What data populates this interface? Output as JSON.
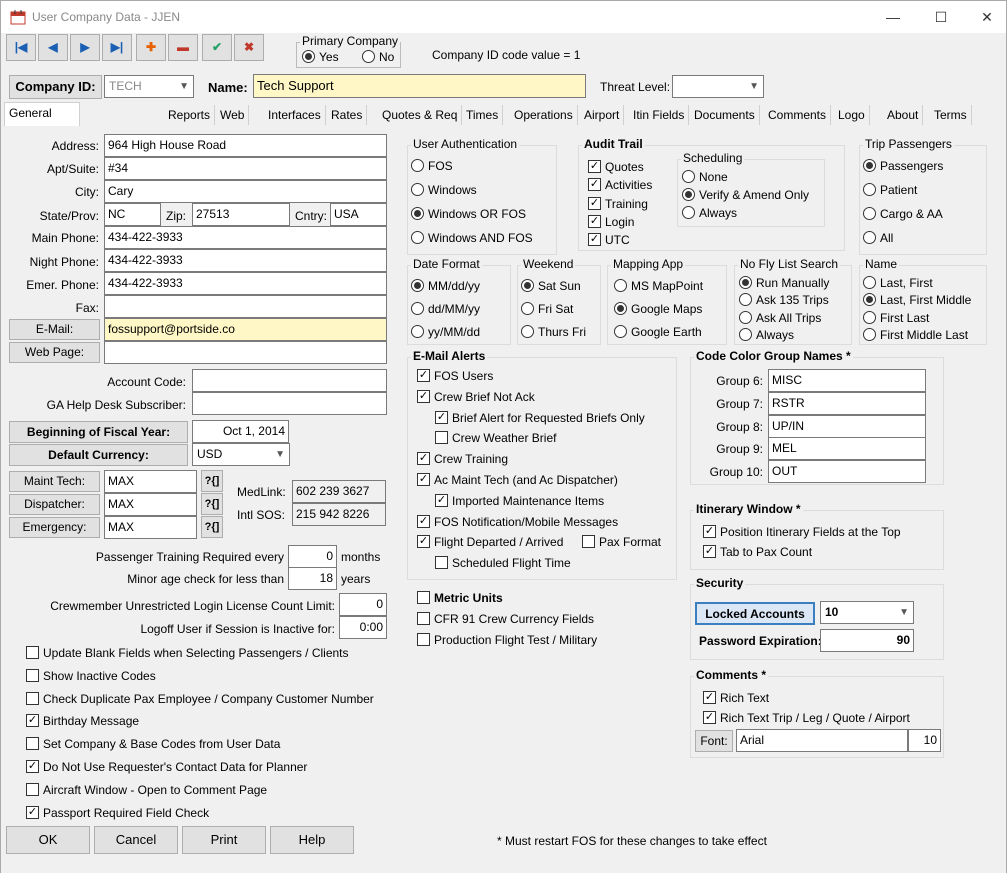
{
  "window": {
    "title": "User Company Data - JJEN",
    "min": "—",
    "max": "☐",
    "close": "✕"
  },
  "toolbar": [
    "|◀",
    "◀",
    "▶",
    "▶|",
    "✚",
    "▬",
    "✔",
    "✖"
  ],
  "primary_company": {
    "label": "Primary Company",
    "yes": "Yes",
    "no": "No",
    "code_value": "Company ID code value = 1"
  },
  "header": {
    "company_id_label": "Company ID:",
    "company_id_value": "TECH",
    "name_label": "Name:",
    "name_value": "Tech Support",
    "threat_label": "Threat Level:",
    "threat_value": ""
  },
  "tabs": [
    "General",
    "Reports",
    "Web",
    "Interfaces",
    "Rates",
    "Quotes & Req",
    "Times",
    "Operations",
    "Airport",
    "Itin Fields",
    "Documents",
    "Comments",
    "Logo",
    "About",
    "Terms"
  ],
  "address": {
    "address_label": "Address:",
    "address": "964 High House Road",
    "apt_label": "Apt/Suite:",
    "apt": "#34",
    "city_label": "City:",
    "city": "Cary",
    "state_label": "State/Prov:",
    "state": "NC",
    "zip_label": "Zip:",
    "zip": "27513",
    "cntry_label": "Cntry:",
    "cntry": "USA",
    "main_phone_label": "Main Phone:",
    "main_phone": "434-422-3933",
    "night_phone_label": "Night Phone:",
    "night_phone": "434-422-3933",
    "emer_phone_label": "Emer. Phone:",
    "emer_phone": "434-422-3933",
    "fax_label": "Fax:",
    "fax": "",
    "email_label": "E-Mail:",
    "email": "fossupport@portside.co",
    "web_label": "Web Page:",
    "web": "",
    "account_code_label": "Account Code:",
    "account_code": "",
    "ga_label": "GA Help Desk Subscriber:",
    "ga": ""
  },
  "fiscal": {
    "fy_label": "Beginning of Fiscal Year:",
    "fy_value": "Oct 1, 2014",
    "currency_label": "Default Currency:",
    "currency_value": "USD"
  },
  "contacts": {
    "maint_label": "Maint Tech:",
    "maint": "MAX",
    "disp_label": "Dispatcher:",
    "disp": "MAX",
    "emer_label": "Emergency:",
    "emer": "MAX",
    "lookup": "?{]",
    "medlink_label": "MedLink:",
    "medlink": "602 239 3627",
    "intl_label": "Intl SOS:",
    "intl": "215 942 8226"
  },
  "misc": {
    "training_label": "Passenger Training Required every",
    "training_value": "0",
    "training_unit": "months",
    "minor_label": "Minor age check for less than",
    "minor_value": "18",
    "minor_unit": "years",
    "license_label": "Crewmember Unrestricted Login License Count Limit:",
    "license_value": "0",
    "logoff_label": "Logoff User if Session is Inactive for:",
    "logoff_value": "0:00"
  },
  "options": [
    {
      "label": "Update Blank Fields when Selecting Passengers / Clients",
      "checked": false
    },
    {
      "label": "Show Inactive Codes",
      "checked": false
    },
    {
      "label": "Check Duplicate Pax Employee / Company Customer Number",
      "checked": false
    },
    {
      "label": "Birthday Message",
      "checked": true
    },
    {
      "label": "Set Company & Base Codes from User Data",
      "checked": false
    },
    {
      "label": "Do Not Use Requester's Contact Data for Planner",
      "checked": true
    },
    {
      "label": "Aircraft Window - Open to Comment Page",
      "checked": false
    },
    {
      "label": "Passport Required Field Check",
      "checked": true
    }
  ],
  "user_auth": {
    "title": "User Authentication",
    "options": [
      "FOS",
      "Windows",
      "Windows OR FOS",
      "Windows AND FOS"
    ],
    "selected": 2
  },
  "audit": {
    "title": "Audit Trail",
    "items": [
      {
        "label": "Quotes",
        "checked": true
      },
      {
        "label": "Activities",
        "checked": true
      },
      {
        "label": "Training",
        "checked": true
      },
      {
        "label": "Login",
        "checked": true
      },
      {
        "label": "UTC",
        "checked": true
      }
    ],
    "scheduling_title": "Scheduling",
    "scheduling": [
      "None",
      "Verify & Amend Only",
      "Always"
    ],
    "scheduling_selected": 1
  },
  "trip_pax": {
    "title": "Trip Passengers",
    "options": [
      "Passengers",
      "Patient",
      "Cargo & AA",
      "All"
    ],
    "selected": 0
  },
  "date_format": {
    "title": "Date Format",
    "options": [
      "MM/dd/yy",
      "dd/MM/yy",
      "yy/MM/dd"
    ],
    "selected": 0
  },
  "weekend": {
    "title": "Weekend",
    "options": [
      "Sat Sun",
      "Fri Sat",
      "Thurs Fri"
    ],
    "selected": 0
  },
  "mapping": {
    "title": "Mapping App",
    "options": [
      "MS MapPoint",
      "Google Maps",
      "Google Earth"
    ],
    "selected": 1
  },
  "nofly": {
    "title": "No Fly List Search",
    "options": [
      "Run Manually",
      "Ask 135 Trips",
      "Ask All Trips",
      "Always"
    ],
    "selected": 0
  },
  "name_fmt": {
    "title": "Name",
    "options": [
      "Last, First",
      "Last, First Middle",
      "First Last",
      "First Middle Last"
    ],
    "selected": 1
  },
  "email_alerts": {
    "title": "E-Mail Alerts",
    "items": [
      {
        "label": "FOS Users",
        "checked": true,
        "indent": 0
      },
      {
        "label": "Crew Brief Not Ack",
        "checked": true,
        "indent": 0
      },
      {
        "label": "Brief Alert for Requested Briefs Only",
        "checked": true,
        "indent": 1
      },
      {
        "label": "Crew Weather Brief",
        "checked": false,
        "indent": 1
      },
      {
        "label": "Crew Training",
        "checked": true,
        "indent": 0
      },
      {
        "label": "Ac Maint Tech (and Ac Dispatcher)",
        "checked": true,
        "indent": 0
      },
      {
        "label": "Imported Maintenance Items",
        "checked": true,
        "indent": 1
      },
      {
        "label": "FOS Notification/Mobile Messages",
        "checked": true,
        "indent": 0
      },
      {
        "label": "Flight Departed / Arrived",
        "checked": true,
        "indent": 0
      },
      {
        "label": "Scheduled Flight Time",
        "checked": false,
        "indent": 1
      }
    ],
    "pax_format": {
      "label": "Pax Format",
      "checked": false
    }
  },
  "more_opts": [
    {
      "label": "Metric Units",
      "checked": false,
      "bold": true
    },
    {
      "label": "CFR 91 Crew Currency Fields",
      "checked": false,
      "bold": false
    },
    {
      "label": "Production Flight Test / Military",
      "checked": false,
      "bold": false
    }
  ],
  "color_groups": {
    "title": "Code Color Group Names *",
    "items": [
      {
        "label": "Group 6:",
        "value": "MISC"
      },
      {
        "label": "Group 7:",
        "value": "RSTR"
      },
      {
        "label": "Group 8:",
        "value": "UP/IN"
      },
      {
        "label": "Group 9:",
        "value": "MEL"
      },
      {
        "label": "Group 10:",
        "value": "OUT"
      }
    ]
  },
  "itinerary": {
    "title": "Itinerary Window *",
    "items": [
      {
        "label": "Position Itinerary Fields at the Top",
        "checked": true
      },
      {
        "label": "Tab to Pax Count",
        "checked": true
      }
    ]
  },
  "security": {
    "title": "Security",
    "locked_label": "Locked Accounts",
    "locked_value": "10",
    "pw_label": "Password Expiration:",
    "pw_value": "90"
  },
  "comments": {
    "title": "Comments *",
    "items": [
      {
        "label": "Rich Text",
        "checked": true
      },
      {
        "label": "Rich Text Trip / Leg / Quote / Airport",
        "checked": true
      }
    ],
    "font_label": "Font:",
    "font_value": "Arial",
    "font_size": "10"
  },
  "footer": {
    "ok": "OK",
    "cancel": "Cancel",
    "print": "Print",
    "help": "Help",
    "note": "* Must restart FOS for these changes to take effect"
  }
}
